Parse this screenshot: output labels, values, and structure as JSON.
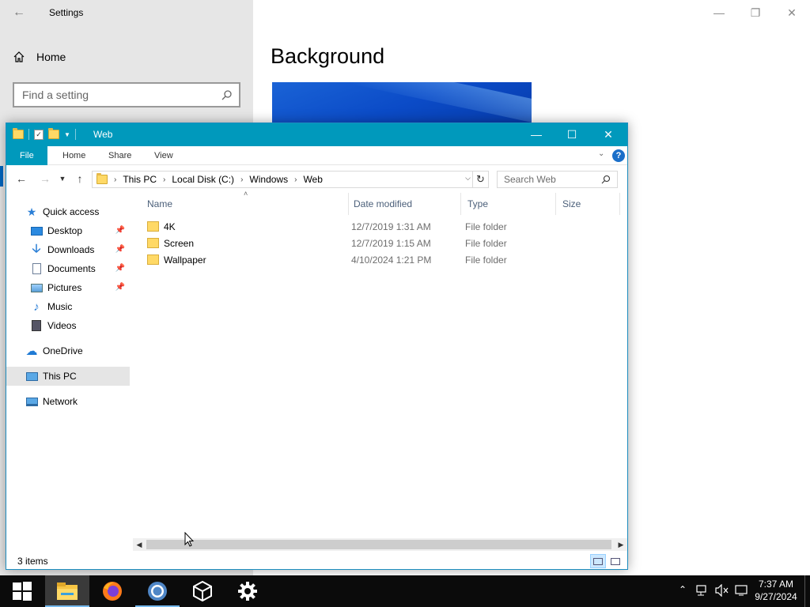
{
  "settings": {
    "window_title": "Settings",
    "home_label": "Home",
    "search_placeholder": "Find a setting",
    "page_title": "Background"
  },
  "explorer": {
    "window_title": "Web",
    "ribbon_tabs": [
      "File",
      "Home",
      "Share",
      "View"
    ],
    "breadcrumb": [
      "This PC",
      "Local Disk (C:)",
      "Windows",
      "Web"
    ],
    "search_placeholder": "Search Web",
    "columns": [
      "Name",
      "Date modified",
      "Type",
      "Size"
    ],
    "nav": {
      "quick_access": "Quick access",
      "desktop": "Desktop",
      "downloads": "Downloads",
      "documents": "Documents",
      "pictures": "Pictures",
      "music": "Music",
      "videos": "Videos",
      "onedrive": "OneDrive",
      "this_pc": "This PC",
      "network": "Network"
    },
    "files": [
      {
        "name": "4K",
        "date": "12/7/2019 1:31 AM",
        "type": "File folder",
        "size": ""
      },
      {
        "name": "Screen",
        "date": "12/7/2019 1:15 AM",
        "type": "File folder",
        "size": ""
      },
      {
        "name": "Wallpaper",
        "date": "4/10/2024 1:21 PM",
        "type": "File folder",
        "size": ""
      }
    ],
    "status": "3 items"
  },
  "taskbar": {
    "apps": [
      "start",
      "file-explorer",
      "firefox",
      "chrome",
      "virtualbox",
      "settings"
    ],
    "time": "7:37 AM",
    "date": "9/27/2024"
  },
  "colors": {
    "explorer_accent": "#0099bc",
    "settings_accent": "#0067c0",
    "taskbar": "#0b0b0b"
  }
}
